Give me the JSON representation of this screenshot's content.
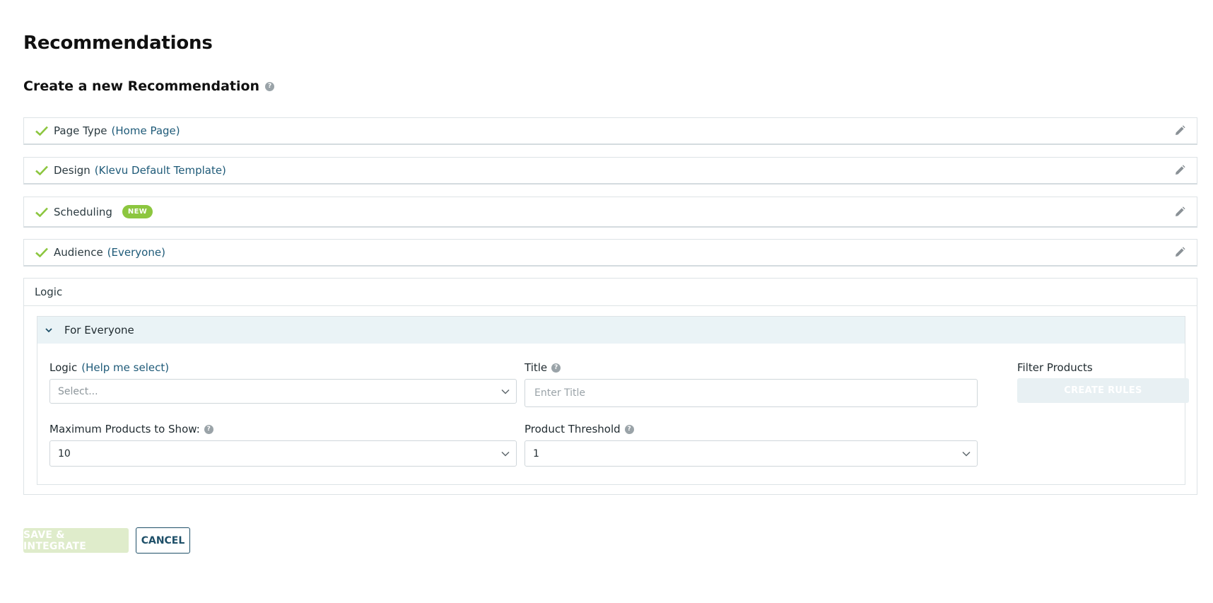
{
  "page": {
    "title": "Recommendations",
    "section_title": "Create a new Recommendation"
  },
  "steps": [
    {
      "label": "Page Type",
      "value": "(Home Page)"
    },
    {
      "label": "Design",
      "value": "(Klevu Default Template)"
    },
    {
      "label": "Scheduling",
      "badge": "NEW"
    },
    {
      "label": "Audience",
      "value": "(Everyone)"
    }
  ],
  "logic": {
    "header": "Logic",
    "segment": {
      "title": "For Everyone",
      "logic_label": "Logic",
      "help_link": "(Help me select)",
      "logic_placeholder": "Select...",
      "title_label": "Title",
      "title_placeholder": "Enter Title",
      "title_value": "",
      "filter_label": "Filter Products",
      "create_rules_label": "CREATE RULES",
      "max_products_label": "Maximum Products to Show:",
      "max_products_value": "10",
      "threshold_label": "Product Threshold",
      "threshold_value": "1"
    }
  },
  "actions": {
    "save_label": "SAVE & INTEGRATE",
    "cancel_label": "CANCEL"
  },
  "colors": {
    "accent_green": "#8cc63f",
    "link_blue": "#1e5a78",
    "header_bg": "#eaf3f6"
  }
}
